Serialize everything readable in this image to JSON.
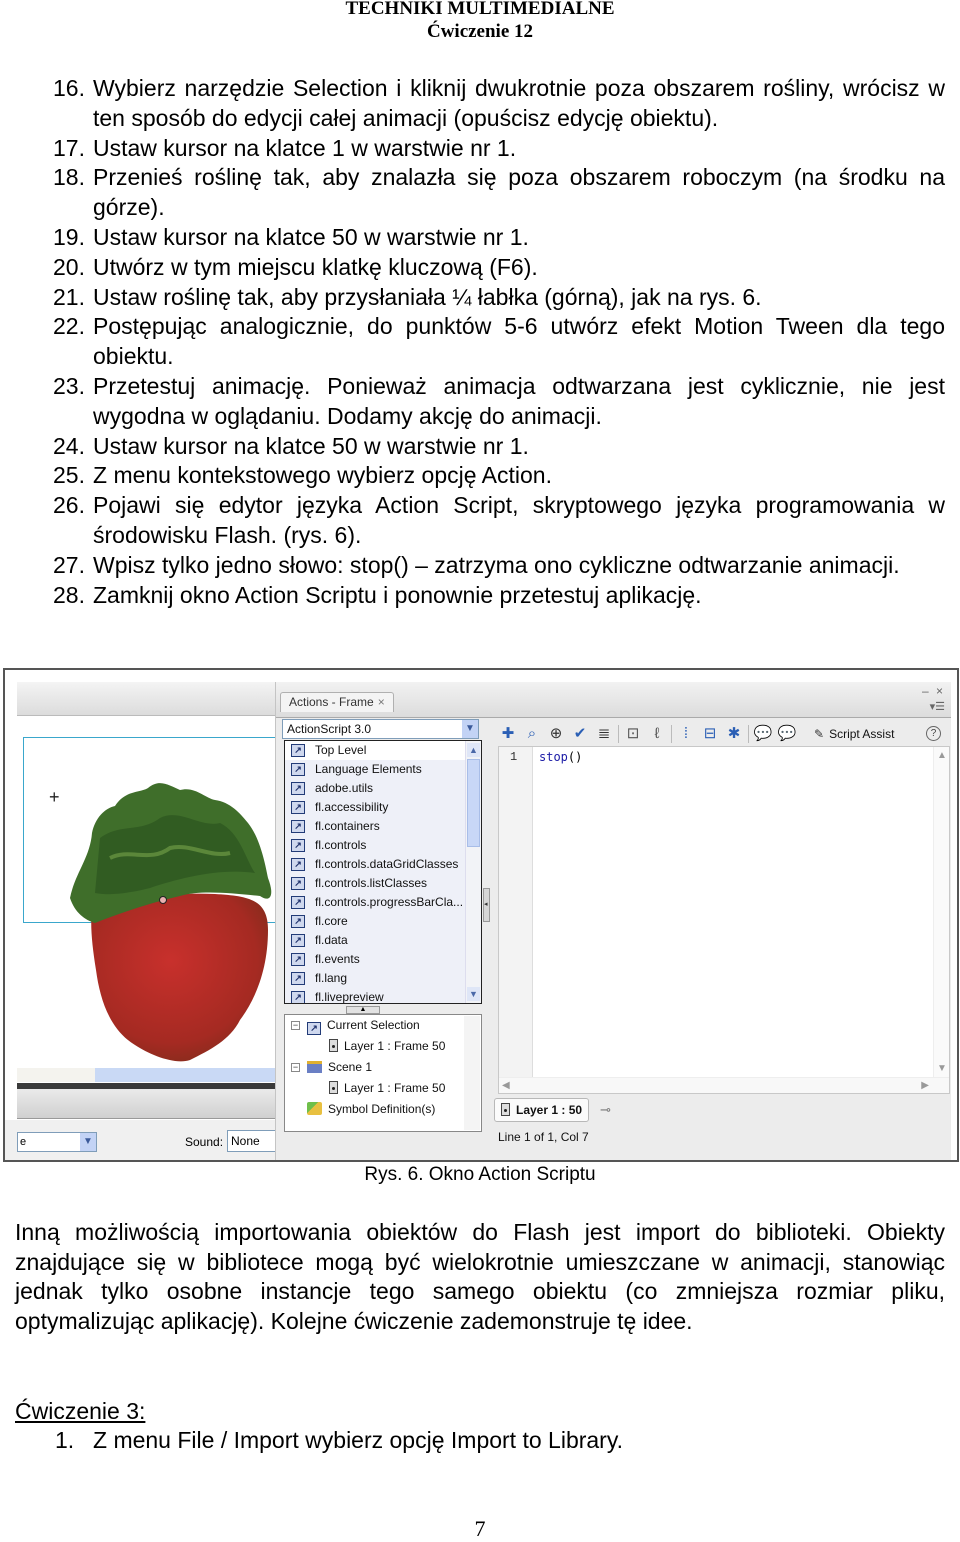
{
  "header": {
    "title": "TECHNIKI MULTIMEDIALNE",
    "subtitle": "Ćwiczenie 12"
  },
  "steps": [
    {
      "num": "16.",
      "text": "Wybierz narzędzie Selection i kliknij dwukrotnie poza obszarem rośliny, wrócisz w ten sposób do edycji całej animacji (opuścisz edycję obiektu)."
    },
    {
      "num": "17.",
      "text": "Ustaw kursor na klatce 1 w warstwie nr 1."
    },
    {
      "num": "18.",
      "text": "Przenieś roślinę tak, aby znalazła się poza obszarem roboczym (na środku na górze)."
    },
    {
      "num": "19.",
      "text": "Ustaw kursor na klatce 50 w warstwie nr 1."
    },
    {
      "num": "20.",
      "text": "Utwórz w tym miejscu klatkę kluczową (F6)."
    },
    {
      "num": "21.",
      "text": "Ustaw roślinę tak, aby przysłaniała ¼ łabłka (górną), jak na rys. 6."
    },
    {
      "num": "22.",
      "text": "Postępując analogicznie, do punktów 5-6 utwórz efekt Motion Tween dla tego obiektu."
    },
    {
      "num": "23.",
      "text": "Przetestuj animację. Ponieważ animacja odtwarzana jest cyklicznie, nie jest wygodna w oglądaniu. Dodamy akcję do animacji."
    },
    {
      "num": "24.",
      "text": "Ustaw kursor na klatce 50 w warstwie nr 1."
    },
    {
      "num": "25.",
      "text": "Z menu kontekstowego wybierz opcję Action."
    },
    {
      "num": "26.",
      "text": "Pojawi się edytor języka Action Script, skryptowego języka programowania w środowisku Flash. (rys. 6)."
    },
    {
      "num": "27.",
      "text": "Wpisz tylko jedno słowo: stop() – zatrzyma ono cykliczne odtwarzanie animacji."
    },
    {
      "num": "28.",
      "text": "Zamknij okno Action Scriptu i ponownie przetestuj aplikację."
    }
  ],
  "figure": {
    "panel_tab": "Actions - Frame",
    "panel_tab_close": "×",
    "window_controls": "– ×",
    "panel_menu": "▾☰",
    "version_select": "ActionScript 3.0",
    "library_items": [
      "Top Level",
      "Language Elements",
      "adobe.utils",
      "fl.accessibility",
      "fl.containers",
      "fl.controls",
      "fl.controls.dataGridClasses",
      "fl.controls.listClasses",
      "fl.controls.progressBarCla...",
      "fl.core",
      "fl.data",
      "fl.events",
      "fl.lang",
      "fl.livepreview"
    ],
    "outline": {
      "current_selection": "Current Selection",
      "current_frame": "Layer 1 : Frame 50",
      "scene": "Scene 1",
      "scene_frame": "Layer 1 : Frame 50",
      "symbols": "Symbol Definition(s)"
    },
    "toolbar_icons": [
      "add-statement",
      "find",
      "target-path",
      "check-syntax",
      "auto-format",
      "code-hint",
      "debug-options",
      "collapse-between-braces",
      "collapse-selection",
      "expand-all",
      "block-comment",
      "line-comment"
    ],
    "script_assist": "Script Assist",
    "help": "?",
    "code": {
      "line_number": "1",
      "keyword": "stop",
      "parens": "()"
    },
    "layer_tab": "Layer 1 : 50",
    "status": "Line 1 of 1, Col 7",
    "props": {
      "left_combo": "e",
      "sound_label": "Sound:",
      "sound_value": "None"
    }
  },
  "caption": "Rys. 6. Okno Action Scriptu",
  "paragraph": "Inną możliwością importowania obiektów do Flash jest import do biblioteki. Obiekty znajdujące się w bibliotece mogą być wielokrotnie umieszczane w animacji, stanowiąc jednak tylko osobne instancje tego samego obiektu (co zmniejsza rozmiar pliku, optymalizując aplikację). Kolejne ćwiczenie zademonstruje tę idee.",
  "exercise": {
    "title": "Ćwiczenie 3:",
    "steps": [
      {
        "num": "1.",
        "text": "Z menu File / Import wybierz opcję Import to Library."
      }
    ]
  },
  "page_number": "7"
}
